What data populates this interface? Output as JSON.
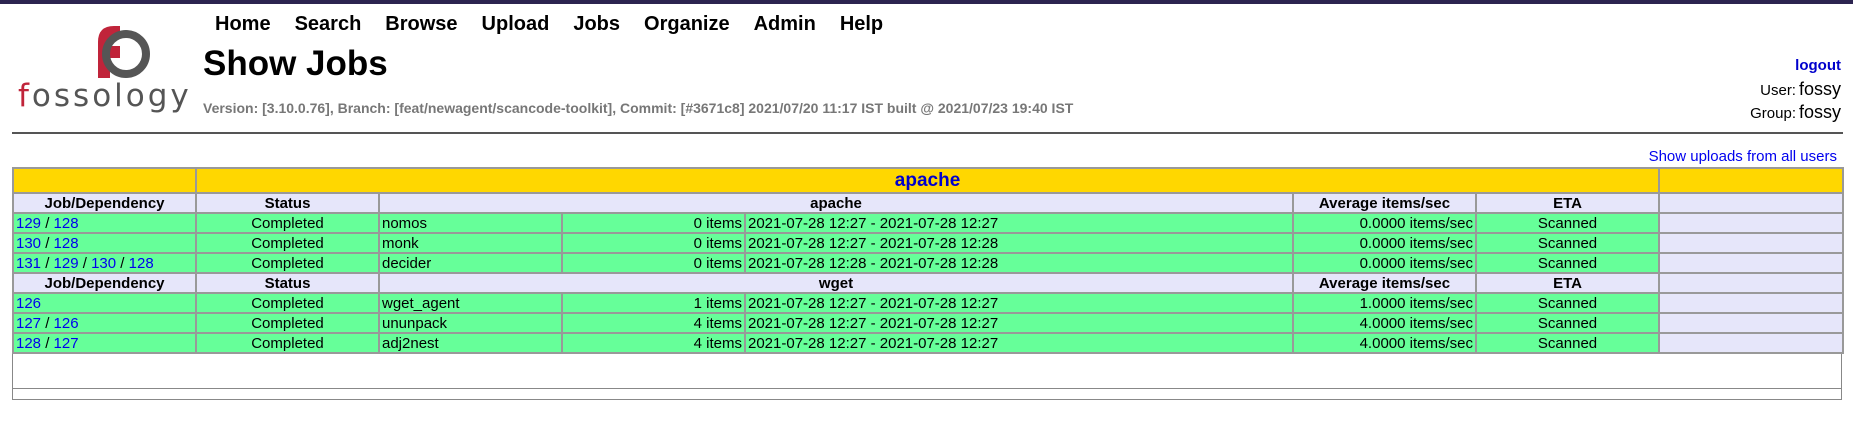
{
  "nav": [
    "Home",
    "Search",
    "Browse",
    "Upload",
    "Jobs",
    "Organize",
    "Admin",
    "Help"
  ],
  "page_title": "Show Jobs",
  "version": "Version: [3.10.0.76], Branch: [feat/newagent/scancode-toolkit], Commit: [#3671c8] 2021/07/20 11:17 IST built @ 2021/07/23 19:40 IST",
  "logo": {
    "text_red": "f",
    "text_rest": "ossology",
    "text_full": "fossology"
  },
  "account": {
    "logout": "logout",
    "user_label": "User:",
    "user": "fossy",
    "group_label": "Group:",
    "group": "fossy"
  },
  "show_all": "Show uploads from all users",
  "upload_title": "apache",
  "columns": {
    "job": "Job/Dependency",
    "status": "Status",
    "avg": "Average items/sec",
    "eta": "ETA"
  },
  "groups": [
    {
      "name": "apache",
      "rows": [
        {
          "job": [
            "129",
            "128"
          ],
          "status": "Completed",
          "agent": "nomos",
          "items": "0 items",
          "time": "2021-07-28 12:27 - 2021-07-28 12:27",
          "avg": "0.0000 items/sec",
          "eta": "Scanned"
        },
        {
          "job": [
            "130",
            "128"
          ],
          "status": "Completed",
          "agent": "monk",
          "items": "0 items",
          "time": "2021-07-28 12:27 - 2021-07-28 12:28",
          "avg": "0.0000 items/sec",
          "eta": "Scanned"
        },
        {
          "job": [
            "131",
            "129",
            "130",
            "128"
          ],
          "status": "Completed",
          "agent": "decider",
          "items": "0 items",
          "time": "2021-07-28 12:28 - 2021-07-28 12:28",
          "avg": "0.0000 items/sec",
          "eta": "Scanned"
        }
      ]
    },
    {
      "name": "wget",
      "rows": [
        {
          "job": [
            "126"
          ],
          "status": "Completed",
          "agent": "wget_agent",
          "items": "1 items",
          "time": "2021-07-28 12:27 - 2021-07-28 12:27",
          "avg": "1.0000 items/sec",
          "eta": "Scanned"
        },
        {
          "job": [
            "127",
            "126"
          ],
          "status": "Completed",
          "agent": "ununpack",
          "items": "4 items",
          "time": "2021-07-28 12:27 - 2021-07-28 12:27",
          "avg": "4.0000 items/sec",
          "eta": "Scanned"
        },
        {
          "job": [
            "128",
            "127"
          ],
          "status": "Completed",
          "agent": "adj2nest",
          "items": "4 items",
          "time": "2021-07-28 12:27 - 2021-07-28 12:27",
          "avg": "4.0000 items/sec",
          "eta": "Scanned"
        }
      ]
    }
  ],
  "colors": {
    "header": "#ffd700",
    "row": "#66ff99",
    "column_header": "#e6e6fa",
    "link": "#0000ee"
  }
}
